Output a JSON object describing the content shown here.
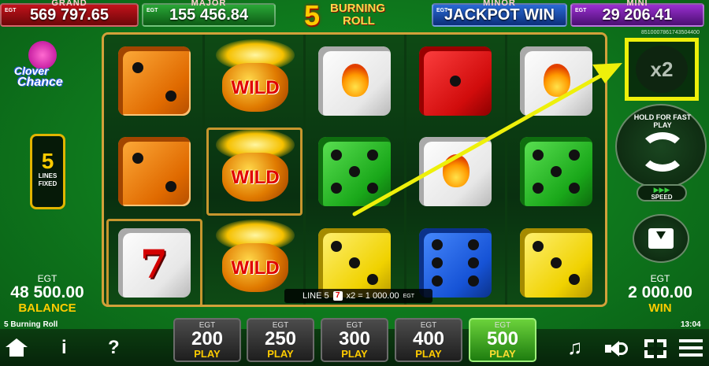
{
  "jackpots": {
    "grand": {
      "caption": "GRAND",
      "value": "569 797.65",
      "provider": "EGT"
    },
    "major": {
      "caption": "MAJOR",
      "value": "155 456.84",
      "provider": "EGT"
    },
    "minor": {
      "caption": "MINOR",
      "value": "JACKPOT WIN",
      "provider": "EGT"
    },
    "mini": {
      "caption": "MINI",
      "value": "29 206.41",
      "provider": "EGT"
    }
  },
  "title": {
    "number": "5",
    "line1": "BURNING",
    "line2": "ROLL"
  },
  "logo": {
    "line1": "Clover",
    "line2": "Chance"
  },
  "lines_fixed": {
    "number": "5",
    "label1": "LINES",
    "label2": "FIXED"
  },
  "balance": {
    "provider": "EGT",
    "amount": "48 500.00",
    "label": "BALANCE"
  },
  "win": {
    "provider": "EGT",
    "amount": "2 000.00",
    "label": "WIN"
  },
  "reels": [
    [
      "orange-die-2",
      "orange-die-2",
      "seven-die"
    ],
    [
      "wild",
      "wild",
      "wild"
    ],
    [
      "flame-die",
      "green-die-5",
      "yellow-die-3"
    ],
    [
      "red-die-1",
      "flame-die",
      "blue-die-6"
    ],
    [
      "flame-die",
      "green-die-5",
      "yellow-die-3"
    ]
  ],
  "line_win": {
    "text_prefix": "LINE 5",
    "symbol": "7",
    "text_suffix": "x2 = 1 000.00",
    "provider": "EGT"
  },
  "serial": "8510007861743504400",
  "multiplier": "x2",
  "spin_button": {
    "label": "HOLD FOR FAST PLAY",
    "icon": "refresh-icon"
  },
  "speed": {
    "arrows": "▶▶▶",
    "label": "SPEED"
  },
  "autoplay_icon": "download-box-icon",
  "game_name": "5 Burning Roll",
  "clock": "13:04",
  "bets": [
    {
      "provider": "EGT",
      "amount": "200",
      "label": "PLAY",
      "active": false
    },
    {
      "provider": "EGT",
      "amount": "250",
      "label": "PLAY",
      "active": false
    },
    {
      "provider": "EGT",
      "amount": "300",
      "label": "PLAY",
      "active": false
    },
    {
      "provider": "EGT",
      "amount": "400",
      "label": "PLAY",
      "active": false
    },
    {
      "provider": "EGT",
      "amount": "500",
      "label": "PLAY",
      "active": true
    }
  ],
  "bottom_icons": {
    "info": "i",
    "help": "?",
    "music": "♫"
  },
  "colors": {
    "highlight": "#eef00a",
    "gold": "#ffcc00",
    "frame": "#d2a13a"
  }
}
